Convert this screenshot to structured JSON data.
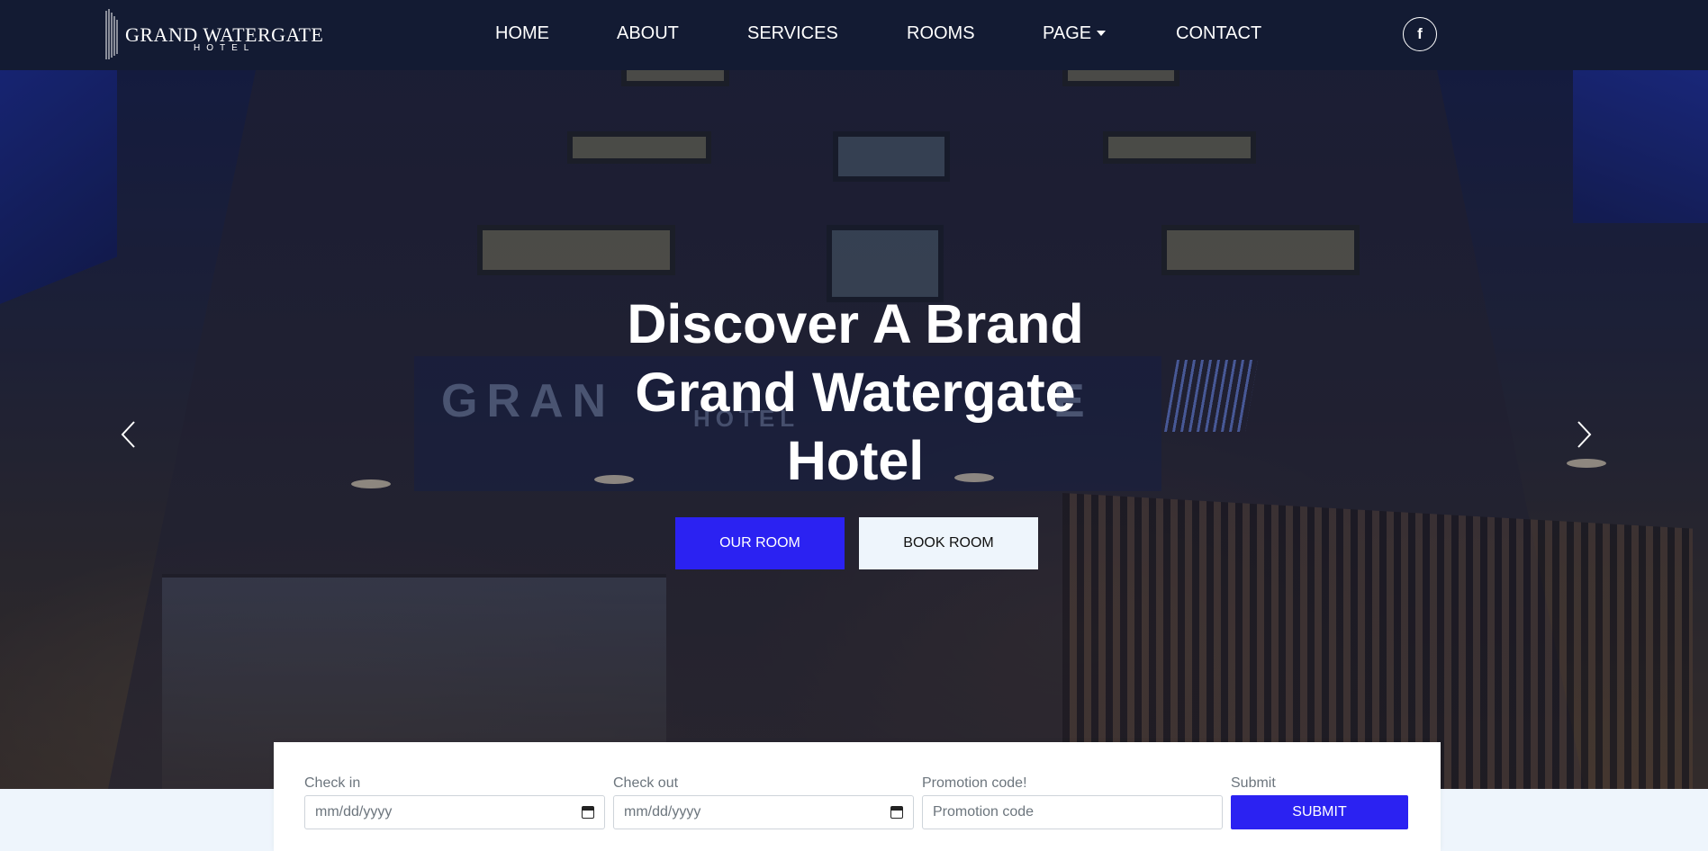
{
  "brand": {
    "name": "GRAND WATERGATE",
    "sub": "HOTEL"
  },
  "nav": {
    "items": [
      {
        "label": "HOME"
      },
      {
        "label": "ABOUT"
      },
      {
        "label": "SERVICES"
      },
      {
        "label": "ROOMS"
      },
      {
        "label": "PAGE"
      },
      {
        "label": "CONTACT"
      }
    ],
    "social_icon": "facebook-icon",
    "social_glyph": "f"
  },
  "hero": {
    "headline_line1": "Discover A Brand",
    "headline_line2": "Grand Watergate",
    "headline_line3": "Hotel",
    "primary_button": "OUR ROOM",
    "secondary_button": "BOOK ROOM",
    "background_sign_text": "GRAN",
    "background_sign_text2": "E",
    "background_sign_sub": "HOTEL"
  },
  "booking": {
    "checkin_label": "Check in",
    "checkin_value": "mm/dd/yyyy",
    "checkout_label": "Check out",
    "checkout_value": "mm/dd/yyyy",
    "promo_label": "Promotion code!",
    "promo_placeholder": "Promotion code",
    "submit_label": "Submit",
    "submit_button": "SUBMIT"
  },
  "colors": {
    "navbar": "#131b33",
    "accent": "#2b22f2",
    "page_bg": "#eef5fc"
  }
}
